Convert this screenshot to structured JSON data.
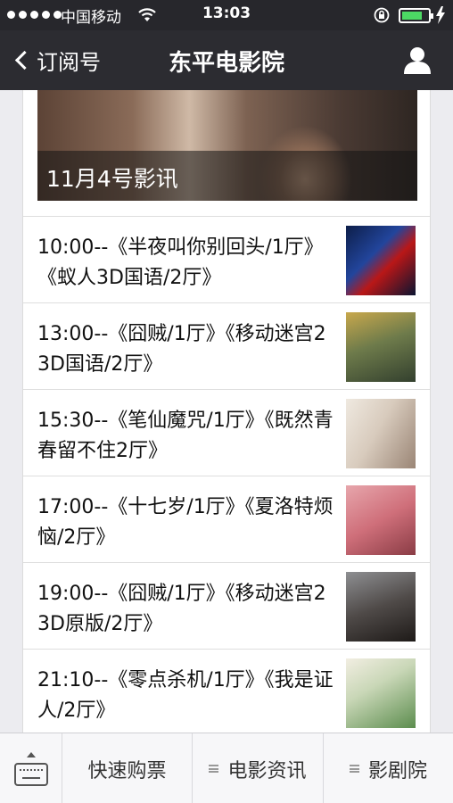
{
  "status_bar": {
    "carrier": "中国移动",
    "time": "13:03",
    "battery_level": 0.8,
    "icons": [
      "signal-dots-icon",
      "wifi-icon",
      "rotation-lock-icon",
      "battery-icon",
      "charging-bolt-icon"
    ]
  },
  "nav": {
    "back_label": "订阅号",
    "title": "东平电影院",
    "user_icon": "person-icon"
  },
  "banner": {
    "caption": "11月4号影讯"
  },
  "schedule": [
    {
      "text": "10:00--《半夜叫你别回头/1厅》《蚁人3D国语/2厅》"
    },
    {
      "text": "13:00--《囧贼/1厅》《移动迷宫2  3D国语/2厅》"
    },
    {
      "text": "15:30--《笔仙魔咒/1厅》《既然青春留不住2厅》"
    },
    {
      "text": "17:00--《十七岁/1厅》《夏洛特烦恼/2厅》"
    },
    {
      "text": "19:00--《囧贼/1厅》《移动迷宫2  3D原版/2厅》"
    },
    {
      "text": "21:10--《零点杀机/1厅》《我是证人/2厅》"
    }
  ],
  "tabbar": {
    "tabs": [
      {
        "label": "快速购票"
      },
      {
        "label": "电影资讯"
      },
      {
        "label": "影剧院"
      }
    ]
  },
  "colors": {
    "status_bg": "#27272c",
    "nav_bg": "#2c2c31",
    "battery": "#4cd964",
    "page_bg": "#ececf0"
  }
}
